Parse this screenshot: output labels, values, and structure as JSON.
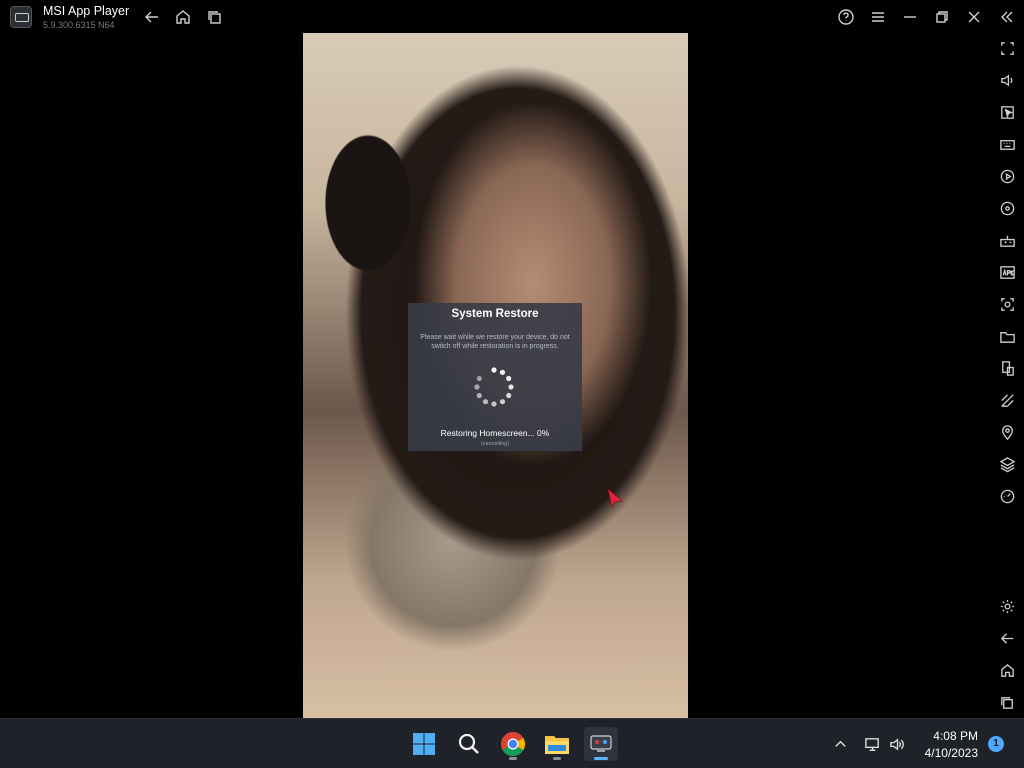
{
  "app": {
    "title": "MSI App Player",
    "version": "5.9.300.6315  N64"
  },
  "dialog": {
    "title": "System Restore",
    "message": "Please wait while we restore your device, do not switch off while restoration is in progress.",
    "status": "Restoring Homescreen... 0%",
    "sub_status": "(cancelling)"
  },
  "taskbar": {
    "clock_time": "4:08 PM",
    "clock_date": "4/10/2023",
    "notification_count": "1"
  },
  "icons": {
    "titlebar": [
      "back-icon",
      "home-icon",
      "recent-apps-icon",
      "help-icon",
      "menu-icon",
      "minimize-icon",
      "restore-icon",
      "close-icon",
      "collapse-sidebar-icon"
    ],
    "sidebar": [
      "fullscreen-icon",
      "volume-icon",
      "pointer-icon",
      "keyboard-icon",
      "macro-icon",
      "sync-icon",
      "gamepad-icon",
      "apk-icon",
      "screenshot-icon",
      "folder-icon",
      "multi-instance-icon",
      "eco-mode-icon",
      "location-icon",
      "layers-icon",
      "performance-icon",
      "settings-icon",
      "back-icon",
      "home-icon",
      "recent-apps-icon"
    ]
  },
  "colors": {
    "dialog_bg": "#383c46",
    "taskbar_bg": "#1f2229",
    "accent": "#4ea8ff",
    "cursor": "#e0283a"
  }
}
